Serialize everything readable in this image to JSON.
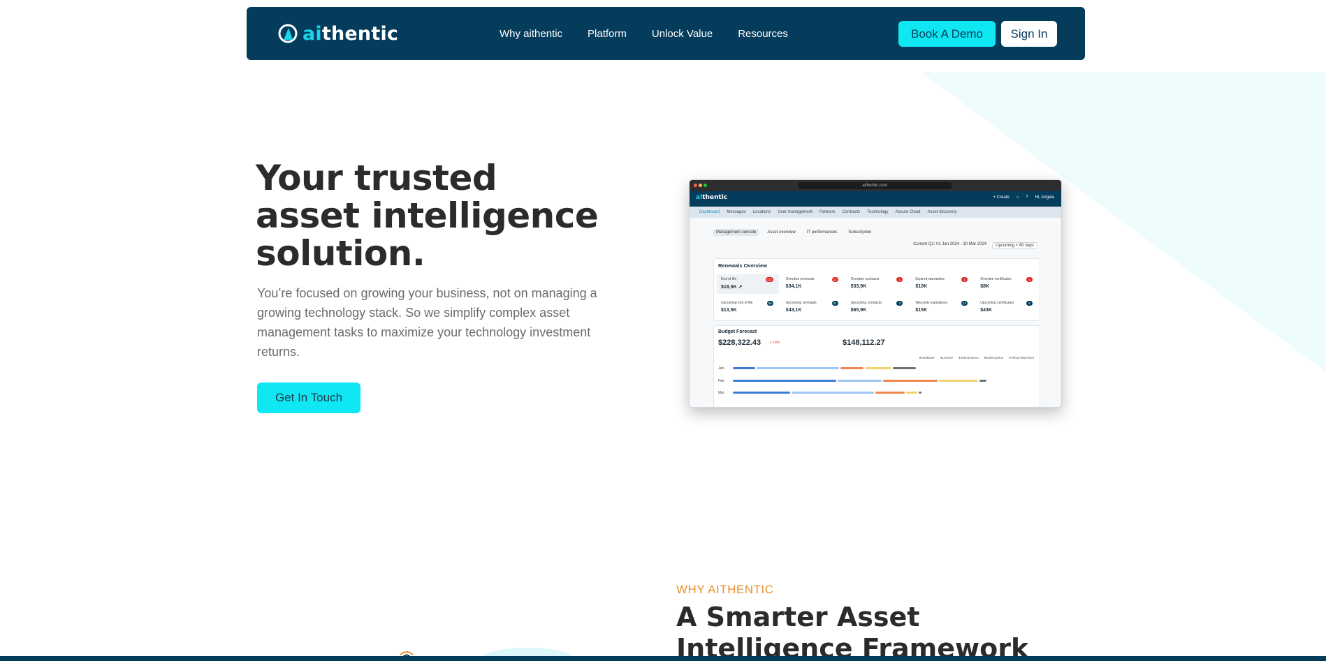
{
  "nav": {
    "logo_prefix": "ai",
    "logo_suffix": "thentic",
    "links": [
      "Why aithentic",
      "Platform",
      "Unlock Value",
      "Resources"
    ],
    "book_demo": "Book A Demo",
    "sign_in": "Sign In"
  },
  "hero": {
    "title_lines": [
      "Your trusted",
      "asset intelligence",
      "solution."
    ],
    "description": "You’re focused on growing your business, not on managing a growing technology stack.  So we simplify complex asset management tasks to maximize your technology investment returns.",
    "cta": "Get In Touch"
  },
  "mockup": {
    "url": "aithentic.com",
    "logo_prefix": "ai",
    "logo_suffix": "thentic",
    "header_actions": [
      "+ Create",
      "⌂",
      "?",
      "Hi, Angela"
    ],
    "nav_items": [
      "Dashboard",
      "Messages",
      "Locations",
      "User management",
      "Partners",
      "Contracts",
      "Technology",
      "Assure Cloud",
      "Asset discovery"
    ],
    "tabs": [
      "Management console",
      "Asset overview",
      "IT performances",
      "Subscription"
    ],
    "date_range": "Current Q1: 01 Jan 2024 - 30 Mar 2024",
    "upcoming_filter": "Upcoming < 60 days",
    "renewals_title": "Renewals Overview",
    "kpis": [
      {
        "label": "End of life",
        "value": "$18,5K ↗",
        "badge": "113",
        "badge_color": "#d92b2b"
      },
      {
        "label": "Overdue renewals",
        "value": "$34,1K",
        "badge": "12",
        "badge_color": "#d92b2b"
      },
      {
        "label": "Overdue contracts",
        "value": "$33,9K",
        "badge": "1",
        "badge_color": "#d92b2b"
      },
      {
        "label": "Expired warranties",
        "value": "$10K",
        "badge": "1",
        "badge_color": "#d92b2b"
      },
      {
        "label": "Overdue certificates",
        "value": "$8K",
        "badge": "1",
        "badge_color": "#d92b2b"
      },
      {
        "label": "Upcoming end of life",
        "value": "$13,5K",
        "badge": "56",
        "badge_color": "#053c5c"
      },
      {
        "label": "Upcoming renewals",
        "value": "$43,1K",
        "badge": "21",
        "badge_color": "#053c5c"
      },
      {
        "label": "Upcoming contracts",
        "value": "$65,9K",
        "badge": "3",
        "badge_color": "#053c5c"
      },
      {
        "label": "Warranty expirations",
        "value": "$15K",
        "badge": "13",
        "badge_color": "#053c5c"
      },
      {
        "label": "Upcoming certificates",
        "value": "$43K",
        "badge": "6",
        "badge_color": "#053c5c"
      }
    ],
    "budget_title": "Budget Forecast",
    "budget_value_1": "$228,322.43",
    "budget_delta": "+ 14%",
    "budget_value_2": "$148,112.27",
    "legend": [
      "Hardware",
      "License",
      "Maintenance",
      "Subscription",
      "Virtual Machines"
    ],
    "months": [
      "Jan",
      "Feb",
      "Mar"
    ],
    "colors": {
      "hardware": "#3a7fd5",
      "license": "#9ec6f0",
      "maintenance": "#ef8450",
      "subscription": "#f3d36a",
      "vm": "#6b7379"
    }
  },
  "why": {
    "eyebrow": "WHY AITHENTIC",
    "title_lines": [
      "A Smarter Asset",
      "Intelligence Framework"
    ]
  }
}
